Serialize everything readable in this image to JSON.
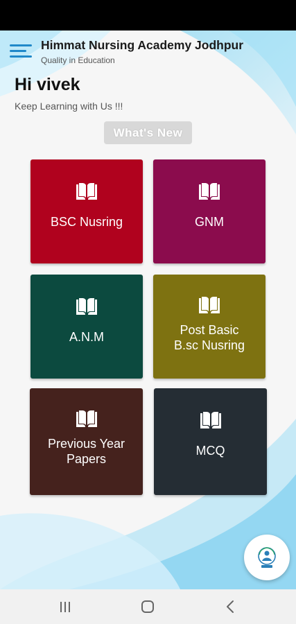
{
  "header": {
    "title": "Himmat Nursing Academy Jodhpur",
    "subtitle": "Quality in Education"
  },
  "greeting": {
    "title": "Hi vivek",
    "subtitle": "Keep Learning with Us !!!"
  },
  "whats_new": {
    "label": "What's New"
  },
  "tiles": [
    {
      "lines": [
        "BSC Nusring"
      ],
      "color": "#b0021e",
      "icon": "book-icon"
    },
    {
      "lines": [
        "GNM"
      ],
      "color": "#8b0c4d",
      "icon": "book-icon"
    },
    {
      "lines": [
        "A.N.M"
      ],
      "color": "#0c4a3f",
      "icon": "book-icon"
    },
    {
      "lines": [
        "Post Basic",
        "B.sc Nusring"
      ],
      "color": "#7e7211",
      "icon": "book-icon"
    },
    {
      "lines": [
        "Previous Year",
        "Papers"
      ],
      "color": "#45221d",
      "icon": "book-icon"
    },
    {
      "lines": [
        "MCQ"
      ],
      "color": "#252d34",
      "icon": "book-icon"
    }
  ],
  "fab": {
    "icon": "academy-logo-icon"
  },
  "nav": {
    "recents_icon": "recents-icon",
    "home_icon": "home-icon",
    "back_icon": "back-icon"
  },
  "colors": {
    "accent": "#1f88c9",
    "wave": "#8fd6f2"
  }
}
